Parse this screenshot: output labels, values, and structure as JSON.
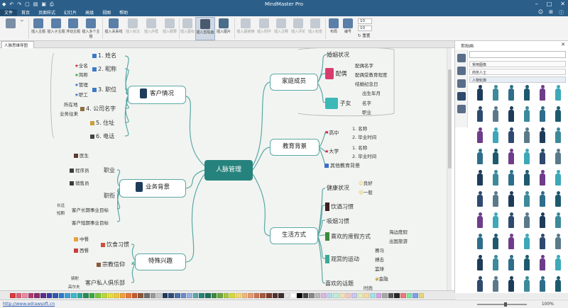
{
  "window": {
    "title": "MindMaster Pro"
  },
  "menu": {
    "items": [
      "文件",
      "首页",
      "页面样式",
      "幻灯片",
      "高级",
      "视图",
      "帮助"
    ]
  },
  "ribbon": {
    "buttons": [
      {
        "label": "插入主题",
        "disabled": false
      },
      {
        "label": "插入子主题",
        "disabled": false
      },
      {
        "label": "浮动主题",
        "disabled": false
      },
      {
        "label": "插入多个主题",
        "disabled": false
      },
      {
        "label": "插入关系线",
        "disabled": false
      },
      {
        "label": "插入标注",
        "disabled": true
      },
      {
        "label": "插入外框",
        "disabled": true
      },
      {
        "label": "插入概要",
        "disabled": true
      },
      {
        "label": "插入图标",
        "disabled": true
      },
      {
        "label": "插入剪贴画",
        "disabled": false
      },
      {
        "label": "插入图片",
        "disabled": false
      },
      {
        "label": "插入超链接",
        "disabled": true
      },
      {
        "label": "插入附件",
        "disabled": true
      },
      {
        "label": "插入注释",
        "disabled": true
      },
      {
        "label": "插入评论",
        "disabled": true
      },
      {
        "label": "插入标签",
        "disabled": true
      },
      {
        "label": "布局",
        "disabled": false
      },
      {
        "label": "编号",
        "disabled": false
      }
    ],
    "spin1": "10",
    "spin2": "10",
    "reset_label": "重置"
  },
  "doc_tab": {
    "label": "人脉思维导图"
  },
  "mindmap": {
    "center": "人脉管理",
    "customer": {
      "title": "客户情况",
      "items": [
        "1. 姓名",
        "2. 昵称",
        "3. 职位",
        "4. 公司名字",
        "5. 住址",
        "6. 电话"
      ],
      "marks": [
        "全名",
        "简称",
        "管理",
        "职工"
      ],
      "tags": [
        "所在地",
        "业务往来"
      ]
    },
    "business": {
      "title": "业务背景",
      "job": "职业",
      "jobs": [
        "医生",
        "程序员",
        "销售员"
      ],
      "title2": "职衔",
      "goals": [
        "客户长期事业目标",
        "客户短期事业目标"
      ],
      "goal_tags": [
        "长远",
        "短期"
      ]
    },
    "hobby": {
      "title": "特殊兴趣",
      "food": "饮食习惯",
      "foods": [
        "中餐",
        "西餐"
      ],
      "religion": "宗教信仰",
      "club": "客户私人俱乐部",
      "club_tags": [
        "骑射",
        "高尔夫"
      ]
    },
    "family": {
      "title": "家庭成员",
      "marriage": "婚姻状况",
      "spouse": "配偶",
      "spouse_items": [
        "配偶名字",
        "配偶受教育程度",
        "结婚纪念日"
      ],
      "child": "子女",
      "child_items": [
        "出生年月",
        "名字",
        "职业"
      ]
    },
    "education": {
      "title": "教育背景",
      "high": "高中",
      "univ": "大学",
      "other": "其他教育背景",
      "sub": [
        "1. 名称",
        "2. 毕业时间"
      ]
    },
    "life": {
      "title": "生活方式",
      "health": "健康状况",
      "health_items": [
        "良好",
        "一般"
      ],
      "drink": "饮酒习惯",
      "smoke": "吸烟习惯",
      "vacation": "喜欢的度假方式",
      "vacation_items": [
        "海边度假",
        "出国旅游"
      ],
      "sport": "观赏的运动",
      "sport_items": [
        "赛马",
        "搏击",
        "篮球"
      ],
      "topic": "喜欢的话题",
      "topic_items": [
        "金融",
        "时尚"
      ]
    }
  },
  "right_panel": {
    "title": "剪贴画",
    "search_placeholder": "",
    "libraries": [
      "常用图像",
      "商务人士",
      "人物轮廓"
    ]
  },
  "status": {
    "link": "http://www.edrawsoft.cn",
    "zoom": "100%"
  },
  "palette": [
    "#d83c3c",
    "#e0607a",
    "#e88aa0",
    "#b03a6e",
    "#8a2e6e",
    "#5a2e8a",
    "#3c3ca8",
    "#2e5aa8",
    "#2e7ac8",
    "#3ca0d8",
    "#3cb8c8",
    "#2ea896",
    "#2e8a5a",
    "#3ca83c",
    "#7ac83c",
    "#b8d83c",
    "#e8e03c",
    "#f0c83c",
    "#f0a03c",
    "#e8783c",
    "#c85a2e",
    "#8a5a3c",
    "#6e6e6e",
    "#9a9a9a",
    "#c8c8c8",
    "#1e3c5a",
    "#2e4a7a",
    "#4a6ea8",
    "#6e8ac8",
    "#9ab0e0",
    "#5aa9a4",
    "#26827c",
    "#1e6e5a",
    "#3c8a3c",
    "#6ea83c",
    "#a8c83c",
    "#d8d83c",
    "#f0d878",
    "#f0b878",
    "#e89a6e",
    "#c8785a",
    "#a85a3c",
    "#7a3c2e",
    "#5a2e2e",
    "#3c2e2e",
    "#e8e8e8",
    "#ffffff",
    "#000000",
    "#444444",
    "#888888",
    "#bbbbbb",
    "#d8b8e0",
    "#b8d8f0",
    "#b8f0d8",
    "#f0e0b8",
    "#f0c8c8",
    "#c8c8f0",
    "#e0f0b8",
    "#f8d8a8",
    "#a8e0e8",
    "#d0a8e0",
    "#a8a8a8",
    "#585858",
    "#282828",
    "#e87a7a",
    "#7ae8a0",
    "#7aa0e8",
    "#e8d87a"
  ]
}
